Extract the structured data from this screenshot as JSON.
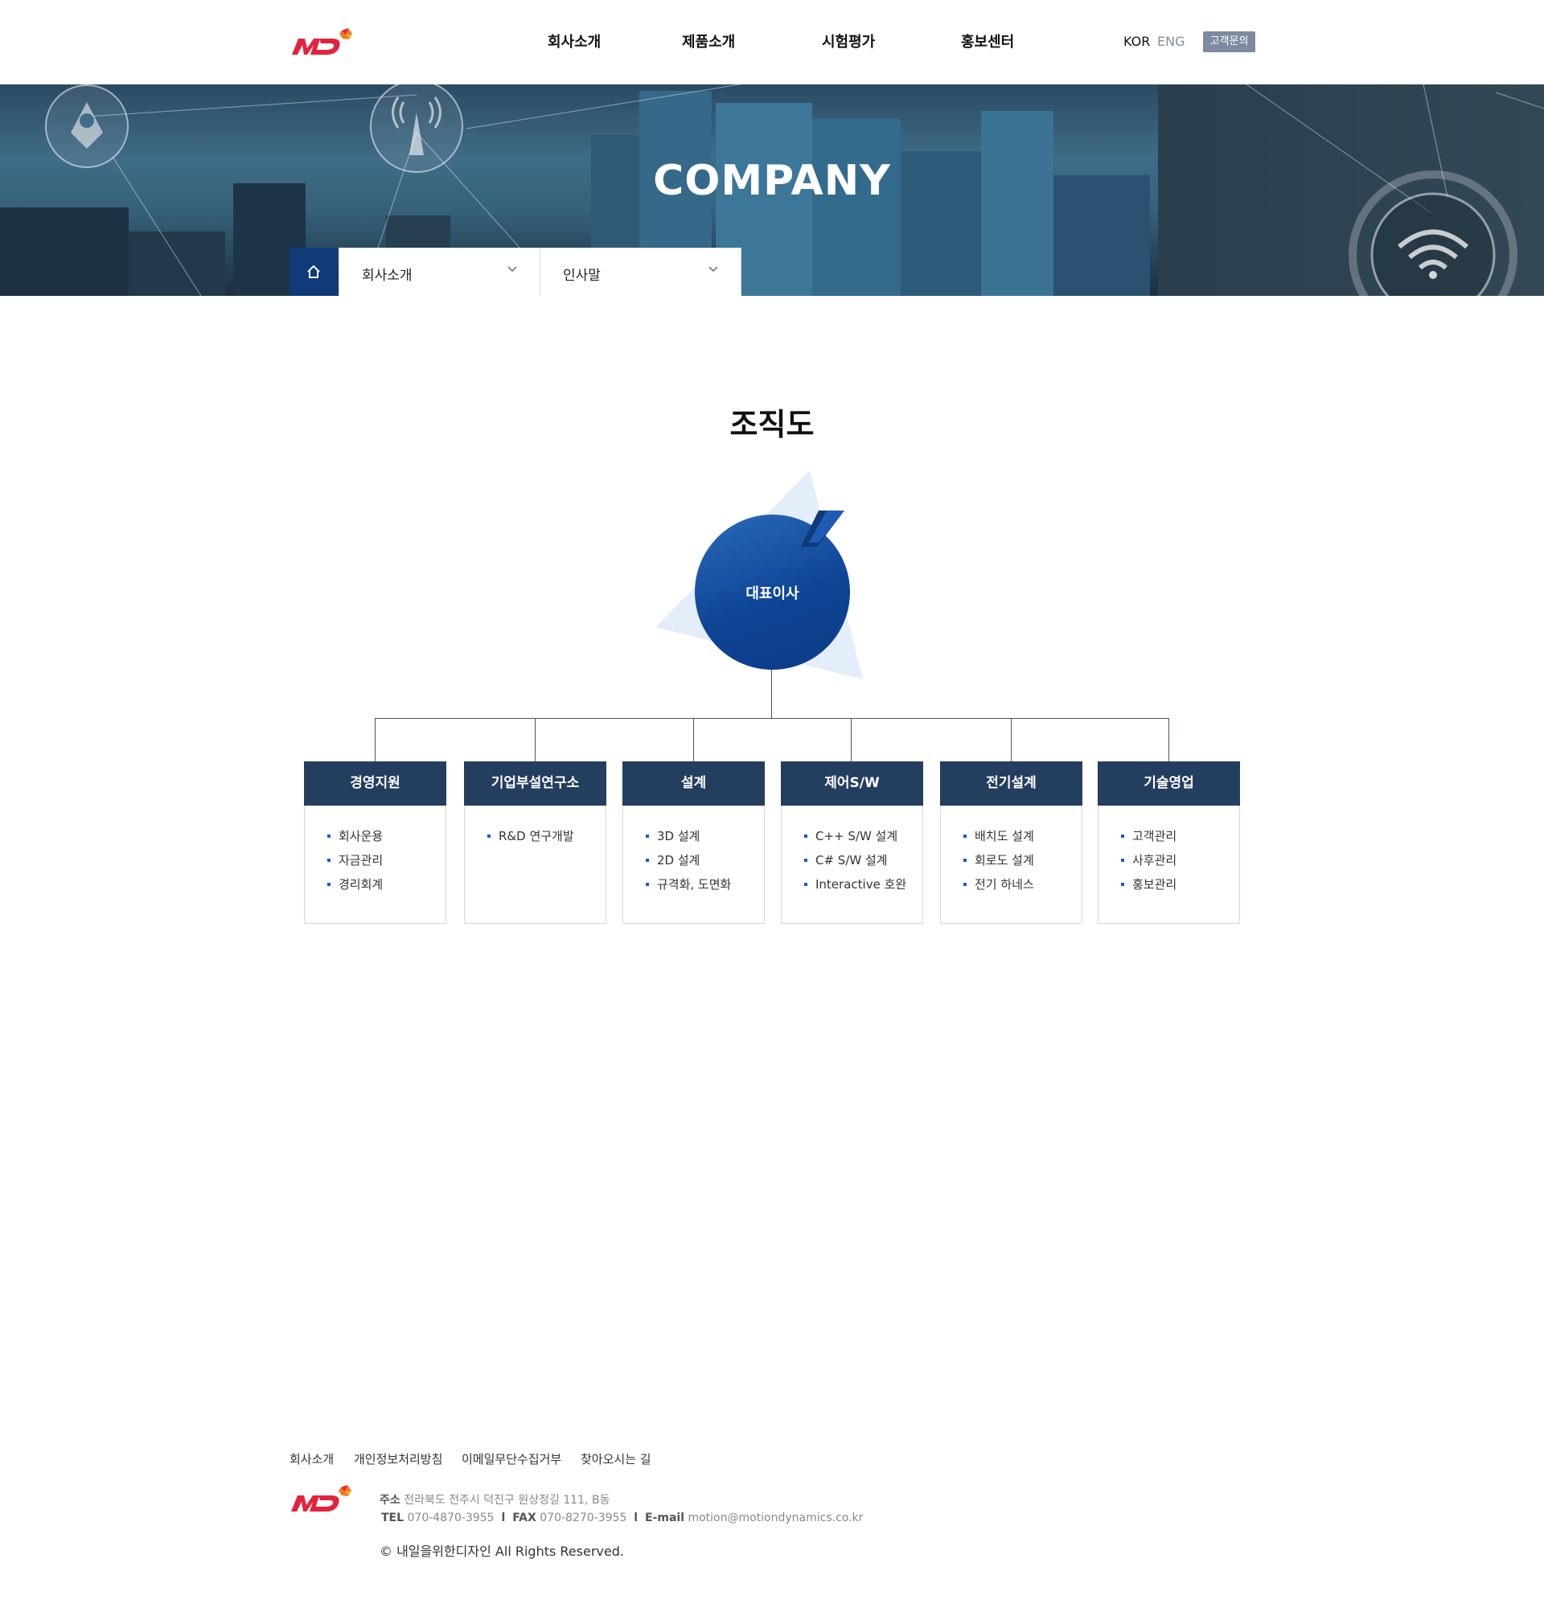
{
  "header": {
    "nav": [
      "회사소개",
      "제품소개",
      "시험평가",
      "홍보센터"
    ],
    "lang_kor": "KOR",
    "lang_eng": "ENG",
    "inquiry": "고객문의"
  },
  "banner": {
    "title": "COMPANY"
  },
  "breadcrumb": {
    "menu1": "회사소개",
    "menu2": "인사말"
  },
  "main": {
    "title": "조직도",
    "ceo": "대표이사",
    "departments": [
      {
        "name": "경영지원",
        "items": [
          "회사운용",
          "자금관리",
          "경리회계"
        ]
      },
      {
        "name": "기업부설연구소",
        "items": [
          "R&D 연구개발"
        ]
      },
      {
        "name": "설계",
        "items": [
          "3D 설계",
          "2D 설계",
          "규격화, 도면화"
        ]
      },
      {
        "name": "제어S/W",
        "items": [
          "C++ S/W 설계",
          "C# S/W 설계",
          "Interactive 호완"
        ]
      },
      {
        "name": "전기설계",
        "items": [
          "배치도 설계",
          "회로도 설계",
          "전기 하네스"
        ]
      },
      {
        "name": "기술영업",
        "items": [
          "고객관리",
          "사후관리",
          "홍보관리"
        ]
      }
    ]
  },
  "footer": {
    "links": [
      "회사소개",
      "개인정보처리방침",
      "이메일무단수집거부",
      "찾아오시는 길"
    ],
    "address_label": "주소",
    "address": "전라북도 전주시 덕진구 원상정길 111, B동",
    "tel_label": "TEL",
    "tel": "070-4870-3955",
    "fax_label": "FAX",
    "fax": "070-8270-3955",
    "email_label": "E-mail",
    "email": "motion@motiondynamics.co.kr",
    "separator": "l",
    "copyright": "© 내일을위한디자인  All Rights Reserved."
  },
  "colors": {
    "brand_red": "#e3233d",
    "navy": "#0f3c78",
    "dept_header": "#243e60"
  }
}
